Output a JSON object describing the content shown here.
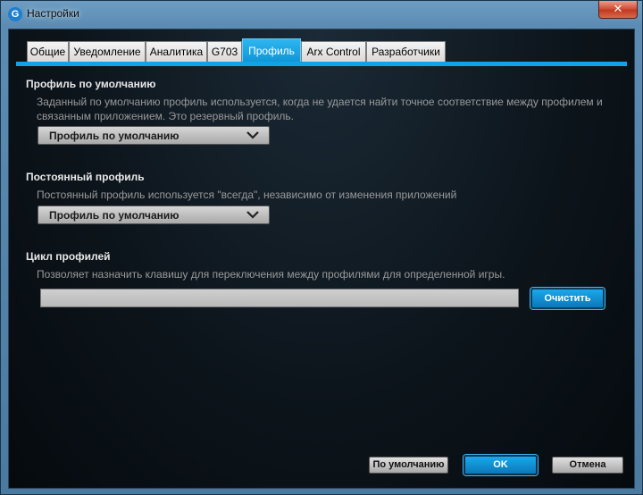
{
  "window": {
    "title": "Настройки",
    "app_icon": "G",
    "close_glyph": "✕"
  },
  "tabs": [
    {
      "label": "Общие",
      "active": false
    },
    {
      "label": "Уведомление",
      "active": false
    },
    {
      "label": "Аналитика",
      "active": false
    },
    {
      "label": "G703",
      "active": false
    },
    {
      "label": "Профиль",
      "active": true
    },
    {
      "label": "Arx Control",
      "active": false
    },
    {
      "label": "Разработчики",
      "active": false
    }
  ],
  "default_profile": {
    "title": "Профиль по умолчанию",
    "description": "Заданный по умолчанию профиль используется, когда не удается найти точное соответствие между профилем и связанным приложением. Это резервный профиль.",
    "selected": "Профиль по умолчанию"
  },
  "persistent_profile": {
    "title": "Постоянный профиль",
    "description": "Постоянный профиль используется \"всегда\", независимо от изменения приложений",
    "selected": "Профиль по умолчанию"
  },
  "profile_cycle": {
    "title": "Цикл профилей",
    "description": "Позволяет назначить клавишу для переключения между профилями для определенной игры.",
    "value": "",
    "clear_label": "Очистить"
  },
  "footer": {
    "default_label": "По умолчанию",
    "ok_label": "OK",
    "cancel_label": "Отмена"
  },
  "colors": {
    "accent": "#12a2e6",
    "background": "#0d151c"
  }
}
